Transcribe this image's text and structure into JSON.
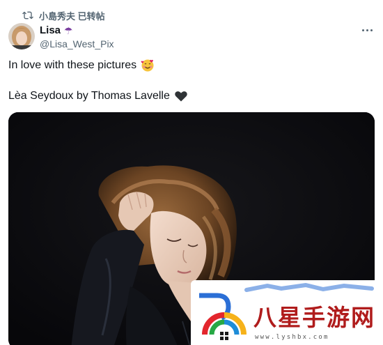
{
  "retweet": {
    "icon": "retweet-icon",
    "text": "小島秀夫 已转帖"
  },
  "author": {
    "name": "Lisa",
    "name_emoji": "☂",
    "name_emoji_icon": "umbrella-icon",
    "handle": "@Lisa_West_Pix",
    "avatar_icon": "avatar"
  },
  "menu": {
    "icon": "more-icon"
  },
  "tweet": {
    "line1": "In love with these pictures",
    "line1_emoji_icon": "smiling-face-with-hearts-icon",
    "line2": "Lèa Seydoux by Thomas Lavelle",
    "line2_emoji_icon": "black-heart-icon"
  },
  "media": {
    "kind": "photo",
    "background": "#0b0b0c"
  },
  "watermark": {
    "title": "八星手游网",
    "url": "www.lyshbx.com",
    "color": "#b01c1c"
  },
  "colors": {
    "text": "#0f1419",
    "secondary": "#536471",
    "background": "#ffffff"
  }
}
